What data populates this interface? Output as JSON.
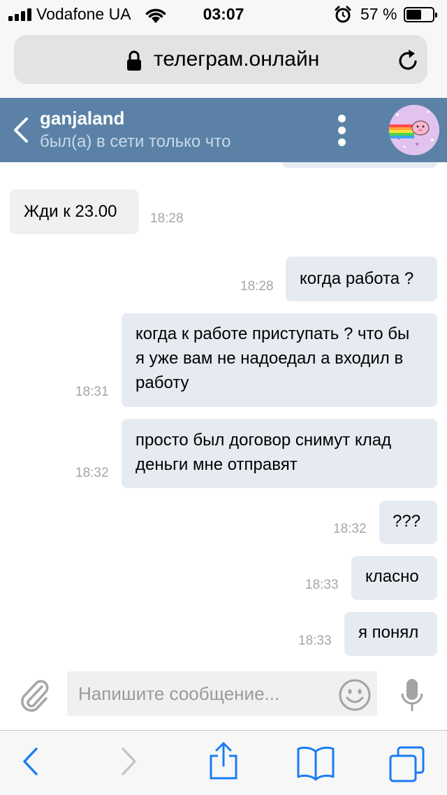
{
  "status_bar": {
    "carrier": "Vodafone UA",
    "time": "03:07",
    "battery_percent": "57 %",
    "battery_level": 0.57,
    "signal_bars": 4
  },
  "browser": {
    "url": "телеграм.онлайн"
  },
  "chat_header": {
    "contact_name": "ganjaland",
    "presence": "был(а) в сети только что"
  },
  "messages": [
    {
      "direction": "in",
      "text": "Жди к 23.00",
      "time": "18:28"
    },
    {
      "direction": "out",
      "text": "когда работа ?",
      "time": "18:28"
    },
    {
      "direction": "out",
      "text": "когда к работе приступать ? что бы я уже вам не надоедал а входил в работу",
      "time": "18:31"
    },
    {
      "direction": "out",
      "text": "просто был договор снимут клад деньги мне отправят",
      "time": "18:32"
    },
    {
      "direction": "out",
      "text": "???",
      "time": "18:32"
    },
    {
      "direction": "out",
      "text": "класно",
      "time": "18:33"
    },
    {
      "direction": "out",
      "text": "я понял",
      "time": "18:33"
    }
  ],
  "composer": {
    "placeholder": "Напишите сообщение..."
  },
  "colors": {
    "header": "#5b82a6",
    "incoming_bubble": "#f0f0f0",
    "outgoing_bubble": "#e5ebf1",
    "ios_blue": "#1a7cf5"
  }
}
